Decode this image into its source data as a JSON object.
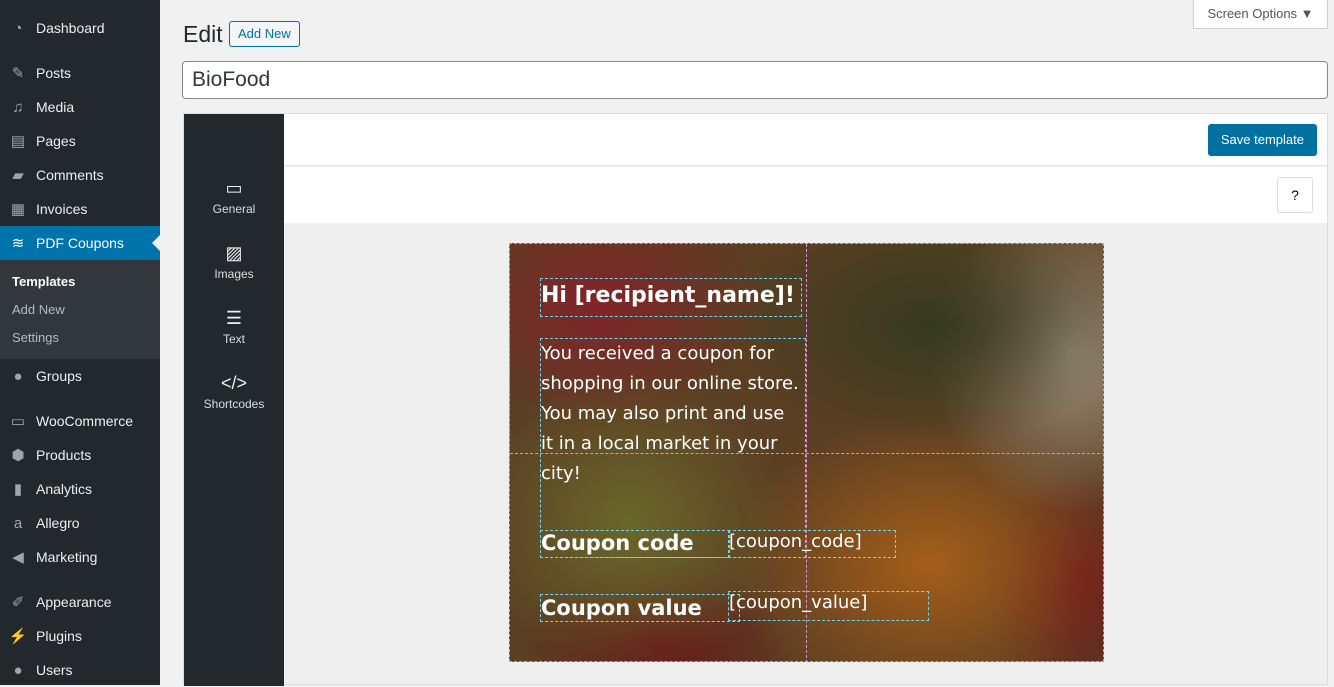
{
  "sidebar": {
    "items": [
      {
        "label": "Dashboard",
        "icon": "dashboard-icon"
      },
      {
        "label": "Posts",
        "icon": "pin-icon"
      },
      {
        "label": "Media",
        "icon": "media-icon"
      },
      {
        "label": "Pages",
        "icon": "pages-icon"
      },
      {
        "label": "Comments",
        "icon": "comment-icon"
      },
      {
        "label": "Invoices",
        "icon": "invoice-icon"
      },
      {
        "label": "PDF Coupons",
        "icon": "coupons-icon"
      },
      {
        "label": "Groups",
        "icon": "groups-icon"
      },
      {
        "label": "WooCommerce",
        "icon": "woo-icon"
      },
      {
        "label": "Products",
        "icon": "box-icon"
      },
      {
        "label": "Analytics",
        "icon": "bar-chart-icon"
      },
      {
        "label": "Allegro",
        "icon": "allegro-icon"
      },
      {
        "label": "Marketing",
        "icon": "megaphone-icon"
      },
      {
        "label": "Appearance",
        "icon": "brush-icon"
      },
      {
        "label": "Plugins",
        "icon": "plug-icon"
      },
      {
        "label": "Users",
        "icon": "user-icon"
      }
    ],
    "submenu": [
      "Templates",
      "Add New",
      "Settings"
    ]
  },
  "header": {
    "title": "Edit",
    "add_new": "Add New",
    "screen_options": "Screen Options ▼"
  },
  "post_title": "BioFood",
  "editor": {
    "tools": [
      {
        "label": "General",
        "icon": "window-icon"
      },
      {
        "label": "Images",
        "icon": "image-icon"
      },
      {
        "label": "Text",
        "icon": "text-icon"
      },
      {
        "label": "Shortcodes",
        "icon": "code-icon"
      }
    ],
    "save": "Save template",
    "help": "?"
  },
  "template": {
    "greeting": "Hi [recipient_name]!",
    "body": "You received a coupon for shopping in our online store. You may also print and use it in a local market in your city!",
    "code_label": "Coupon code",
    "code_value": "[coupon_code]",
    "value_label": "Coupon value",
    "value_value": "[coupon_value]"
  }
}
